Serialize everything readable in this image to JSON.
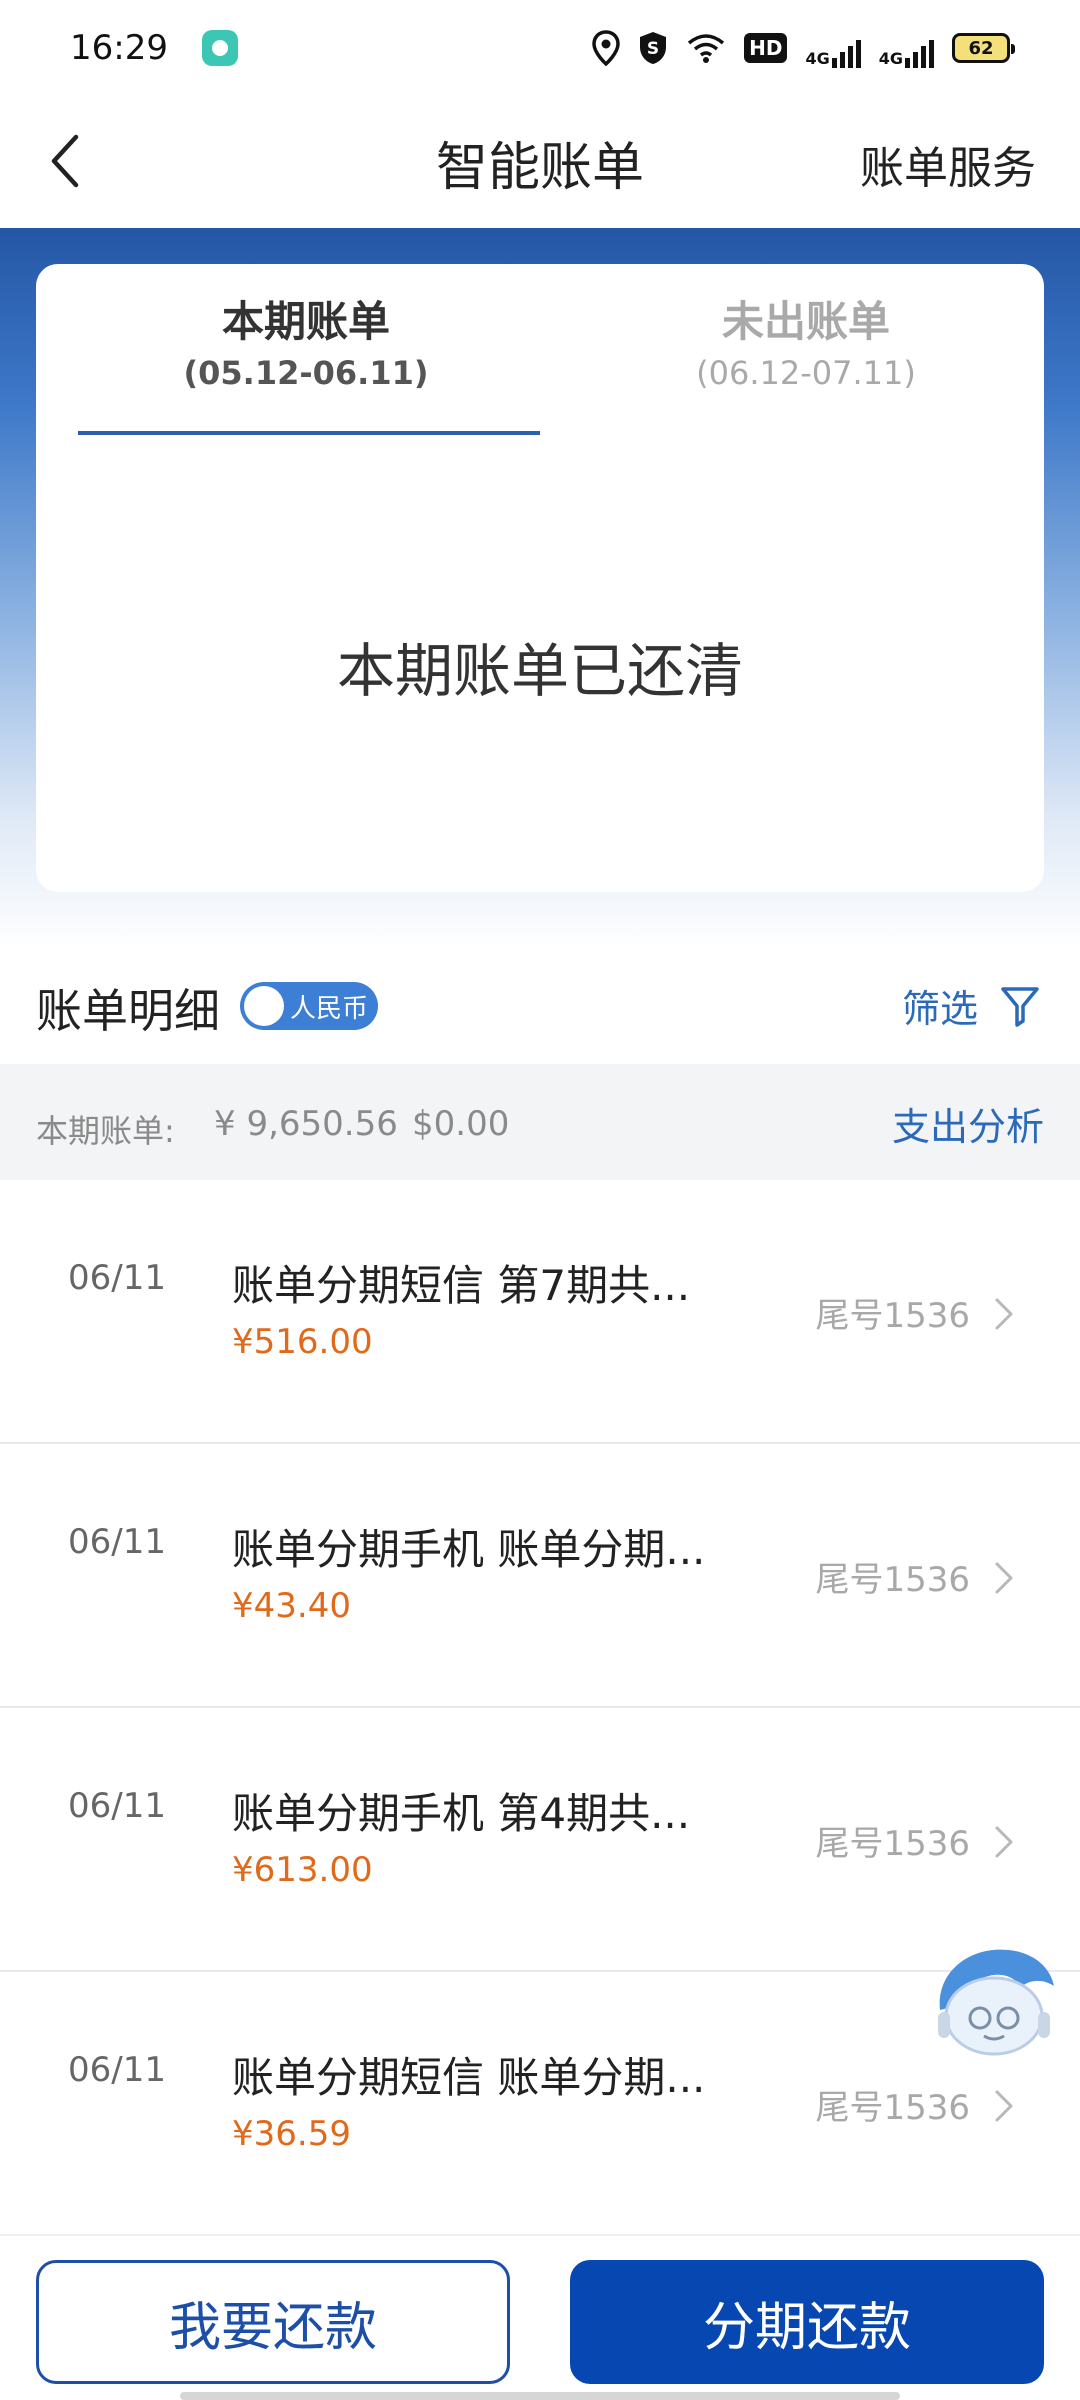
{
  "status_bar": {
    "time": "16:29",
    "hd_label": "HD",
    "net1": "4G",
    "net2": "4G",
    "battery": "62"
  },
  "header": {
    "title": "智能账单",
    "right_action": "账单服务"
  },
  "tabs": [
    {
      "title": "本期账单",
      "range": "(05.12-06.11)",
      "active": true
    },
    {
      "title": "未出账单",
      "range": "(06.12-07.11)",
      "active": false
    }
  ],
  "card": {
    "message": "本期账单已还清"
  },
  "detail": {
    "title": "账单明细",
    "currency_toggle": "人民币",
    "filter_label": "筛选"
  },
  "summary": {
    "label": "本期账单:",
    "rmb_amount": "¥ 9,650.56",
    "usd_amount": "$0.00",
    "analysis_link": "支出分析"
  },
  "transactions": [
    {
      "date": "06/11",
      "desc": "账单分期短信 第7期共...",
      "amount": "¥516.00",
      "card": "尾号1536"
    },
    {
      "date": "06/11",
      "desc": "账单分期手机 账单分期...",
      "amount": "¥43.40",
      "card": "尾号1536"
    },
    {
      "date": "06/11",
      "desc": "账单分期手机 第4期共...",
      "amount": "¥613.00",
      "card": "尾号1536"
    },
    {
      "date": "06/11",
      "desc": "账单分期短信 账单分期...",
      "amount": "¥36.59",
      "card": "尾号1536"
    }
  ],
  "buttons": {
    "repay": "我要还款",
    "installment": "分期还款"
  },
  "colors": {
    "primary": "#0747b2",
    "link": "#2b6ab8",
    "amount": "#e06a1b"
  }
}
